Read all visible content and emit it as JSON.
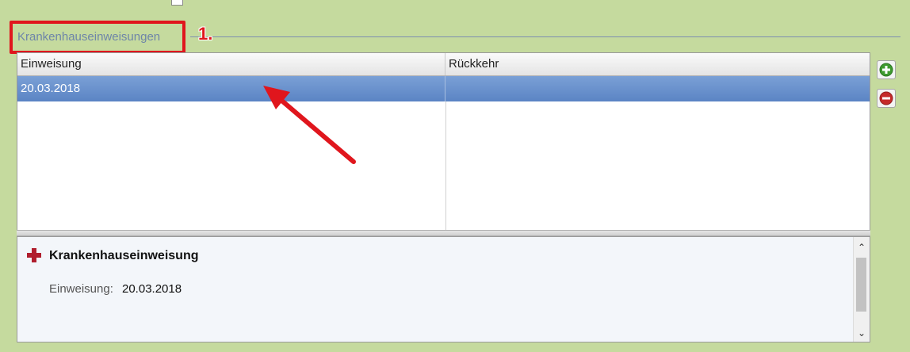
{
  "group": {
    "title": "Krankenhauseinweisungen",
    "annotation_number": "1."
  },
  "grid": {
    "columns": [
      "Einweisung",
      "Rückkehr"
    ],
    "rows": [
      {
        "einweisung": "20.03.2018",
        "rueckkehr": ""
      }
    ],
    "selected_row_index": 0
  },
  "details": {
    "icon": "red-cross-icon",
    "title": "Krankenhauseinweisung",
    "field_label": "Einweisung:",
    "field_value": "20.03.2018"
  },
  "side_buttons": {
    "add_icon": "plus-circle-icon",
    "remove_icon": "minus-circle-icon"
  },
  "colors": {
    "background": "#c5da9e",
    "selection": "#6a93cf",
    "annotation": "#e0161d",
    "group_title": "#6e85a8"
  }
}
